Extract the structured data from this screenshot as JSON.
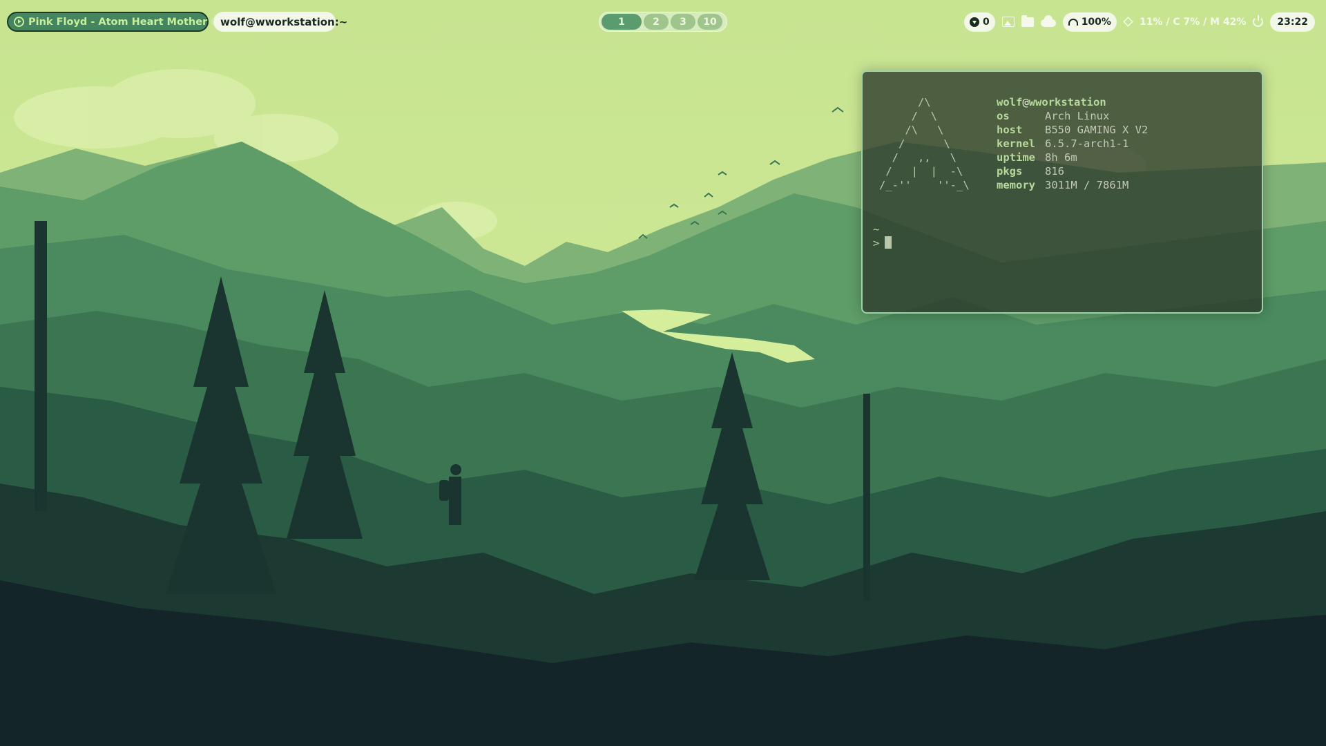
{
  "topbar": {
    "media": {
      "title": "Pink Floyd - Atom Heart Mother",
      "play_icon": "play-circle-icon",
      "service_icon": "spotify-icon"
    },
    "window_title": "wolf@wworkstation:~",
    "workspaces": [
      {
        "label": "1",
        "active": true
      },
      {
        "label": "2",
        "active": false
      },
      {
        "label": "3",
        "active": false
      },
      {
        "label": "10",
        "active": false
      }
    ],
    "status": {
      "downloads": "0",
      "tray_icons": [
        "image-icon",
        "folder-icon",
        "cloud-icon"
      ],
      "volume": "100%",
      "resources": "11% / C 7% / M 42%",
      "clock": "23:22"
    }
  },
  "terminal": {
    "ascii_art": "      /\\\n     /  \\\n    /\\   \\\n   /      \\\n  /   ,,   \\\n /   |  |  -\\\n/_-''    ''-_\\",
    "user": "wolf",
    "at": "@",
    "host": "wworkstation",
    "fetch": [
      {
        "key": "os",
        "value": "Arch Linux"
      },
      {
        "key": "host",
        "value": "B550 GAMING X V2"
      },
      {
        "key": "kernel",
        "value": "6.5.7-arch1-1"
      },
      {
        "key": "uptime",
        "value": "8h 6m"
      },
      {
        "key": "pkgs",
        "value": "816"
      },
      {
        "key": "memory",
        "value": "3011M / 7861M"
      }
    ],
    "cwd": "~",
    "prompt": ">"
  },
  "colors": {
    "sky": "#c7e491",
    "accent": "#44845e",
    "terminal_border": "#9fd3a7",
    "terminal_key": "#b7d99c"
  }
}
